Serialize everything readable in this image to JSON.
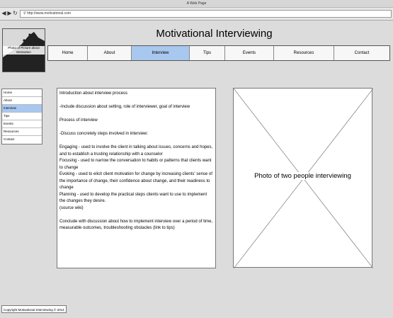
{
  "browser": {
    "window_title": "A Web Page",
    "url": "http://www.motivational.com"
  },
  "header": {
    "logo_caption": "Photo of Picture about Motivation",
    "site_title": "Motivational Interviewing"
  },
  "topnav": {
    "items": [
      "Home",
      "About",
      "Interview",
      "Tips",
      "Events",
      "Resources",
      "Contact"
    ],
    "active": "Interview"
  },
  "sidenav": {
    "items": [
      "Home",
      "About",
      "Interview",
      "Tips",
      "Events",
      "Resources",
      "Contact"
    ],
    "active": "Interview"
  },
  "main": {
    "intro": "Introduction about interview process",
    "intro_detail": "-Include discussion about setting, role of interviewer, goal of interview",
    "process_heading": "Process of interview",
    "process_detail": "-Discuss concretely steps involved in interview:",
    "step_engaging": "Engaging - used to involve the client in talking about issues, concerns and hopes, and to establish a trusting relationship with a counselor",
    "step_focusing": "Focusing - used to narrow the conversation to habits or patterns that clients want to change",
    "step_evoking": "Evoking - used to elicit client motivation for change by increasing clients' sense of the importance of change, their confidence about change, and their readiness to change",
    "step_planning": "Planning - used to develop the practical steps clients want to use to implement the changes they desire.",
    "source": "(source wiki)",
    "conclusion": "Conclude with discussion about how to implement interview over a period of time, measurable outcomes, troubleshooting obstacles (link to tips)"
  },
  "photo": {
    "label": "Photo of two people interviewing"
  },
  "footer": {
    "copyright": "Copyright Motivational Interviewing © 2014"
  }
}
